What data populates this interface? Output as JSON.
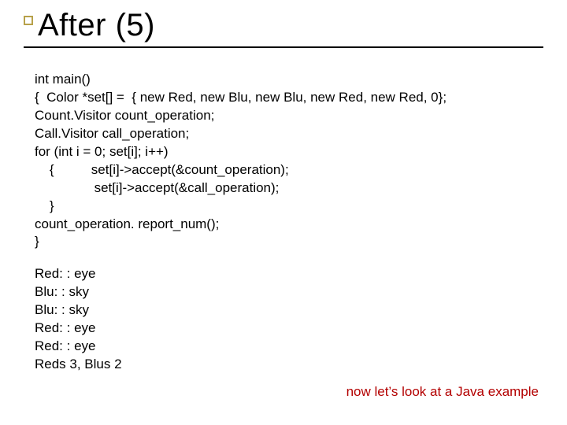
{
  "title": "After (5)",
  "code": {
    "l1": "int main()",
    "l2": "{  Color *set[] =  { new Red, new Blu, new Blu, new Red, new Red, 0};",
    "l3": "Count.Visitor count_operation;",
    "l4": "Call.Visitor call_operation;",
    "l5": "for (int i = 0; set[i]; i++)",
    "l6": "    {          set[i]->accept(&count_operation);",
    "l7": "                set[i]->accept(&call_operation);",
    "l8": "    }",
    "l9": "count_operation. report_num();",
    "l10": "}"
  },
  "output": {
    "o1": "Red: : eye",
    "o2": "Blu: : sky",
    "o3": "Blu: : sky",
    "o4": "Red: : eye",
    "o5": "Red: : eye",
    "o6": "Reds 3, Blus 2"
  },
  "note": "now let’s look at a Java example"
}
